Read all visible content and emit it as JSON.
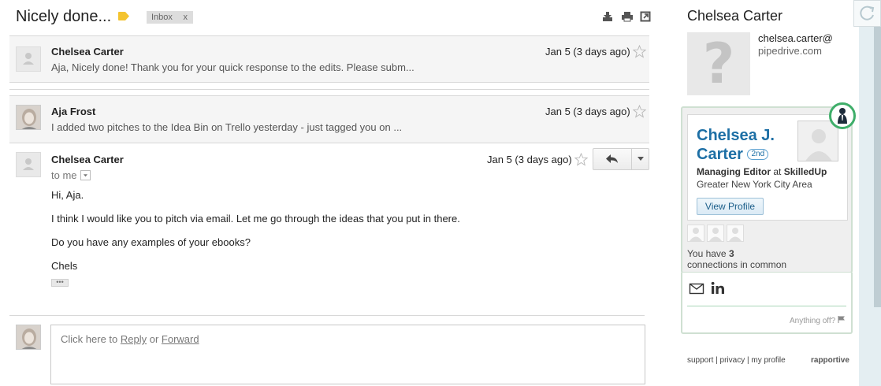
{
  "thread": {
    "subject": "Nicely done...",
    "label_chip": "Inbox",
    "label_chip_close": "x",
    "label_color": "#f4c430"
  },
  "messages": [
    {
      "sender": "Chelsea Carter",
      "date": "Jan 5 (3 days ago)",
      "snippet": "Aja, Nicely done! Thank you for your quick response to the edits. Please subm..."
    },
    {
      "sender": "Aja Frost",
      "date": "Jan 5 (3 days ago)",
      "snippet": "I added two pitches to the Idea Bin on Trello yesterday - just tagged you on ..."
    }
  ],
  "open_message": {
    "sender": "Chelsea Carter",
    "date": "Jan 5 (3 days ago)",
    "to_label": "to me",
    "body": [
      "Hi, Aja.",
      "I think I would like you to pitch via email. Let me go through the ideas that you put in there.",
      "Do you have any examples of your ebooks?",
      "Chels"
    ],
    "trimmed_content": "•••"
  },
  "reply": {
    "prefix": "Click here to ",
    "reply_link": "Reply",
    "middle": " or ",
    "forward_link": "Forward"
  },
  "sidebar": {
    "contact_name": "Chelsea Carter",
    "avatar_placeholder": "?",
    "email_user": "chelsea.carter@",
    "email_domain": "pipedrive.com",
    "linkedin": {
      "name_first": "Chelsea J.",
      "name_last": "Carter",
      "degree": "2nd",
      "title": "Managing Editor",
      "at": " at ",
      "company": "SkilledUp",
      "location": "Greater New York City Area",
      "view_profile": "View Profile",
      "connections_prefix": "You have ",
      "connections_count": "3",
      "connections_suffix": "connections in common"
    },
    "anything_off": "Anything off?",
    "footer": {
      "support": "support",
      "privacy": "privacy",
      "my_profile": "my profile",
      "sep": " | ",
      "brand": "rapportive"
    },
    "accent_color": "#3fae6a",
    "link_color": "#1d6fa5"
  },
  "icons": [
    "label-tag-icon",
    "save-icon",
    "print-icon",
    "new-window-icon",
    "star-icon",
    "reply-arrow-icon",
    "dropdown-arrow-icon",
    "mail-icon",
    "linkedin-icon",
    "flag-icon"
  ]
}
